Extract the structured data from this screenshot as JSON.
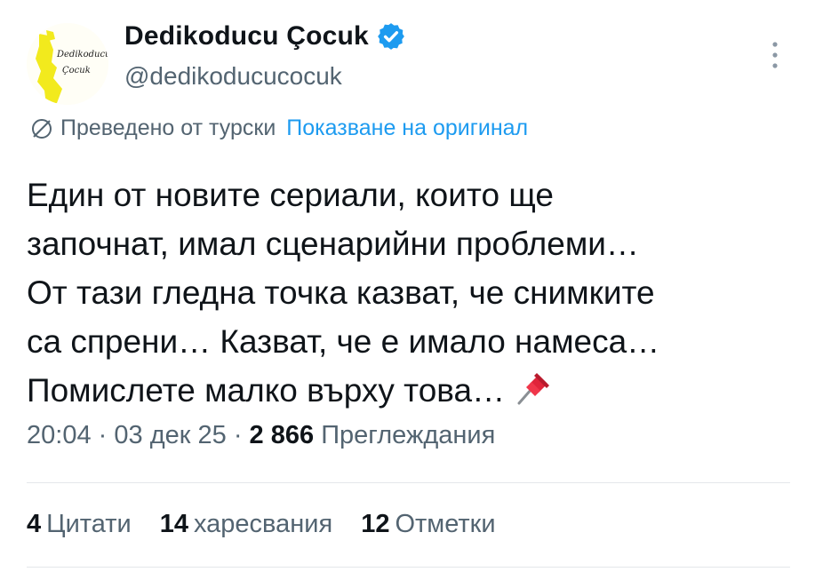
{
  "author": {
    "display_name": "Dedikoducu Çocuk",
    "handle": "@dedikoducucocuk",
    "verified": true,
    "avatar_text_top": "Dedikoducu",
    "avatar_text_bottom": "Çocuk"
  },
  "translation": {
    "label": "Преведено от турски",
    "show_original": "Показване на оригинал"
  },
  "tweet": {
    "lines": [
      "Един от новите сериали, които ще",
      "започнат, имал сценарийни проблеми…",
      "От тази гледна точка казват, че снимките",
      "са спрени… Казват, че е имало намеса…",
      "Помислете малко върху това…"
    ],
    "emoji": "pushpin-icon"
  },
  "meta": {
    "time": "20:04",
    "separator": "·",
    "date": "03 дек 25",
    "views_count": "2 866",
    "views_label": "Преглеждания"
  },
  "stats": {
    "quotes_count": "4",
    "quotes_label": "Цитати",
    "likes_count": "14",
    "likes_label": "харесвания",
    "bookmarks_count": "12",
    "bookmarks_label": "Отметки"
  },
  "colors": {
    "text": "#0f1419",
    "secondary": "#536471",
    "link": "#1d9bf0",
    "verified": "#1d9bf0",
    "avatar_figure": "#f2ea1d",
    "divider": "#e4e7ea"
  }
}
